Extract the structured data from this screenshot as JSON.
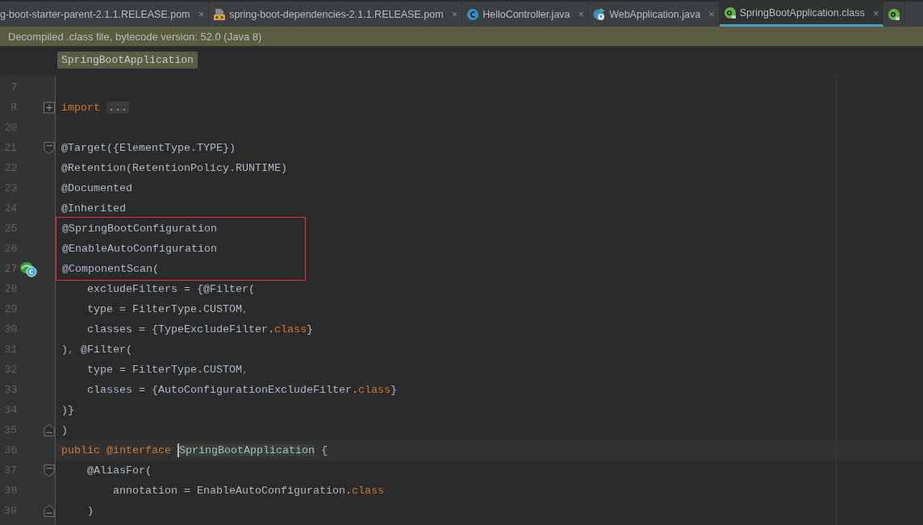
{
  "tabs": [
    {
      "label": "g-boot-starter-parent-2.1.1.RELEASE.pom",
      "kind": "plain",
      "selected": false,
      "close": "×"
    },
    {
      "label": "spring-boot-dependencies-2.1.1.RELEASE.pom",
      "kind": "maven",
      "selected": false,
      "close": "×"
    },
    {
      "label": "HelloController.java",
      "kind": "class",
      "selected": false,
      "close": "×"
    },
    {
      "label": "WebApplication.java",
      "kind": "runnable",
      "selected": false,
      "close": "×"
    },
    {
      "label": "SpringBootApplication.class",
      "kind": "annotation",
      "selected": true,
      "close": "×"
    },
    {
      "kind": "annotation",
      "selected": false
    }
  ],
  "banner": {
    "text": "Decompiled .class file, bytecode version: 52.0 (Java 8)"
  },
  "breadcrumb": {
    "label": "SpringBootApplication"
  },
  "editor": {
    "lines": [
      {
        "number": "7",
        "kind": "plain",
        "boxed": false,
        "gutter_icon": false
      },
      {
        "number": "8",
        "kind": "collapsed",
        "boxed": false,
        "gutter_icon": false,
        "tokens": [
          {
            "t": "import",
            "kind": "keyword"
          },
          {
            "t": "...",
            "kind": "folded"
          }
        ]
      },
      {
        "number": "20",
        "kind": "plain",
        "boxed": false,
        "gutter_icon": false
      },
      {
        "number": "21",
        "kind": "start",
        "boxed": false,
        "gutter_icon": false,
        "tokens": [
          {
            "t": "@Target({ElementType.TYPE})",
            "kind": "text"
          }
        ]
      },
      {
        "number": "22",
        "kind": "plain",
        "boxed": false,
        "gutter_icon": false,
        "tokens": [
          {
            "t": "@Retention(RetentionPolicy.RUNTIME)",
            "kind": "text"
          }
        ]
      },
      {
        "number": "23",
        "kind": "plain",
        "boxed": false,
        "gutter_icon": false,
        "tokens": [
          {
            "t": "@Documented",
            "kind": "text"
          }
        ]
      },
      {
        "number": "24",
        "kind": "plain",
        "boxed": false,
        "gutter_icon": false,
        "tokens": [
          {
            "t": "@Inherited",
            "kind": "text"
          }
        ]
      },
      {
        "number": "25",
        "kind": "plain",
        "boxed": true,
        "gutter_icon": false,
        "tokens": [
          {
            "t": "@SpringBootConfiguration",
            "kind": "text"
          }
        ]
      },
      {
        "number": "26",
        "kind": "plain",
        "boxed": true,
        "gutter_icon": false,
        "tokens": [
          {
            "t": "@EnableAutoConfiguration",
            "kind": "text"
          }
        ]
      },
      {
        "number": "27",
        "kind": "plain",
        "boxed": true,
        "gutter_icon": true,
        "tokens": [
          {
            "t": "@ComponentScan(",
            "kind": "text"
          }
        ]
      },
      {
        "number": "28",
        "kind": "plain",
        "boxed": false,
        "gutter_icon": false,
        "tokens": [
          {
            "t": "    excludeFilters = {@Filter(",
            "kind": "text"
          }
        ]
      },
      {
        "number": "29",
        "kind": "plain",
        "boxed": false,
        "gutter_icon": false,
        "tokens": [
          {
            "t": "    type = FilterType.CUSTOM",
            "kind": "text"
          },
          {
            "t": ",",
            "kind": "keyword"
          }
        ]
      },
      {
        "number": "30",
        "kind": "plain",
        "boxed": false,
        "gutter_icon": false,
        "tokens": [
          {
            "t": "    classes = {TypeExcludeFilter.",
            "kind": "text"
          },
          {
            "t": "class",
            "kind": "keyword"
          },
          {
            "t": "}",
            "kind": "text"
          }
        ]
      },
      {
        "number": "31",
        "kind": "plain",
        "boxed": false,
        "gutter_icon": false,
        "tokens": [
          {
            "t": ")",
            "kind": "text"
          },
          {
            "t": ",",
            "kind": "keyword"
          },
          {
            "t": " @Filter(",
            "kind": "text"
          }
        ]
      },
      {
        "number": "32",
        "kind": "plain",
        "boxed": false,
        "gutter_icon": false,
        "tokens": [
          {
            "t": "    type = FilterType.CUSTOM",
            "kind": "text"
          },
          {
            "t": ",",
            "kind": "keyword"
          }
        ]
      },
      {
        "number": "33",
        "kind": "plain",
        "boxed": false,
        "gutter_icon": false,
        "tokens": [
          {
            "t": "    classes = {AutoConfigurationExcludeFilter.",
            "kind": "text"
          },
          {
            "t": "class",
            "kind": "keyword"
          },
          {
            "t": "}",
            "kind": "text"
          }
        ]
      },
      {
        "number": "34",
        "kind": "plain",
        "boxed": false,
        "gutter_icon": false,
        "tokens": [
          {
            "t": ")}",
            "kind": "text"
          }
        ]
      },
      {
        "number": "35",
        "kind": "end",
        "boxed": false,
        "gutter_icon": false,
        "tokens": [
          {
            "t": ")",
            "kind": "text"
          }
        ]
      },
      {
        "number": "36",
        "kind": "plain",
        "boxed": false,
        "gutter_icon": false,
        "tokens": [
          {
            "t": "public @interface",
            "kind": "keyword"
          },
          {
            "t": "SpringBootApplication",
            "kind": "caret"
          },
          {
            "t": " {",
            "kind": "text"
          }
        ]
      },
      {
        "number": "37",
        "kind": "start",
        "boxed": false,
        "gutter_icon": false,
        "tokens": [
          {
            "t": "    @AliasFor(",
            "kind": "text"
          }
        ]
      },
      {
        "number": "38",
        "kind": "plain",
        "boxed": false,
        "gutter_icon": false,
        "tokens": [
          {
            "t": "        annotation = EnableAutoConfiguration.",
            "kind": "text"
          },
          {
            "t": "class",
            "kind": "keyword"
          }
        ]
      },
      {
        "number": "39",
        "kind": "end",
        "boxed": false,
        "gutter_icon": false,
        "tokens": [
          {
            "t": "    )",
            "kind": "text"
          }
        ]
      }
    ]
  }
}
